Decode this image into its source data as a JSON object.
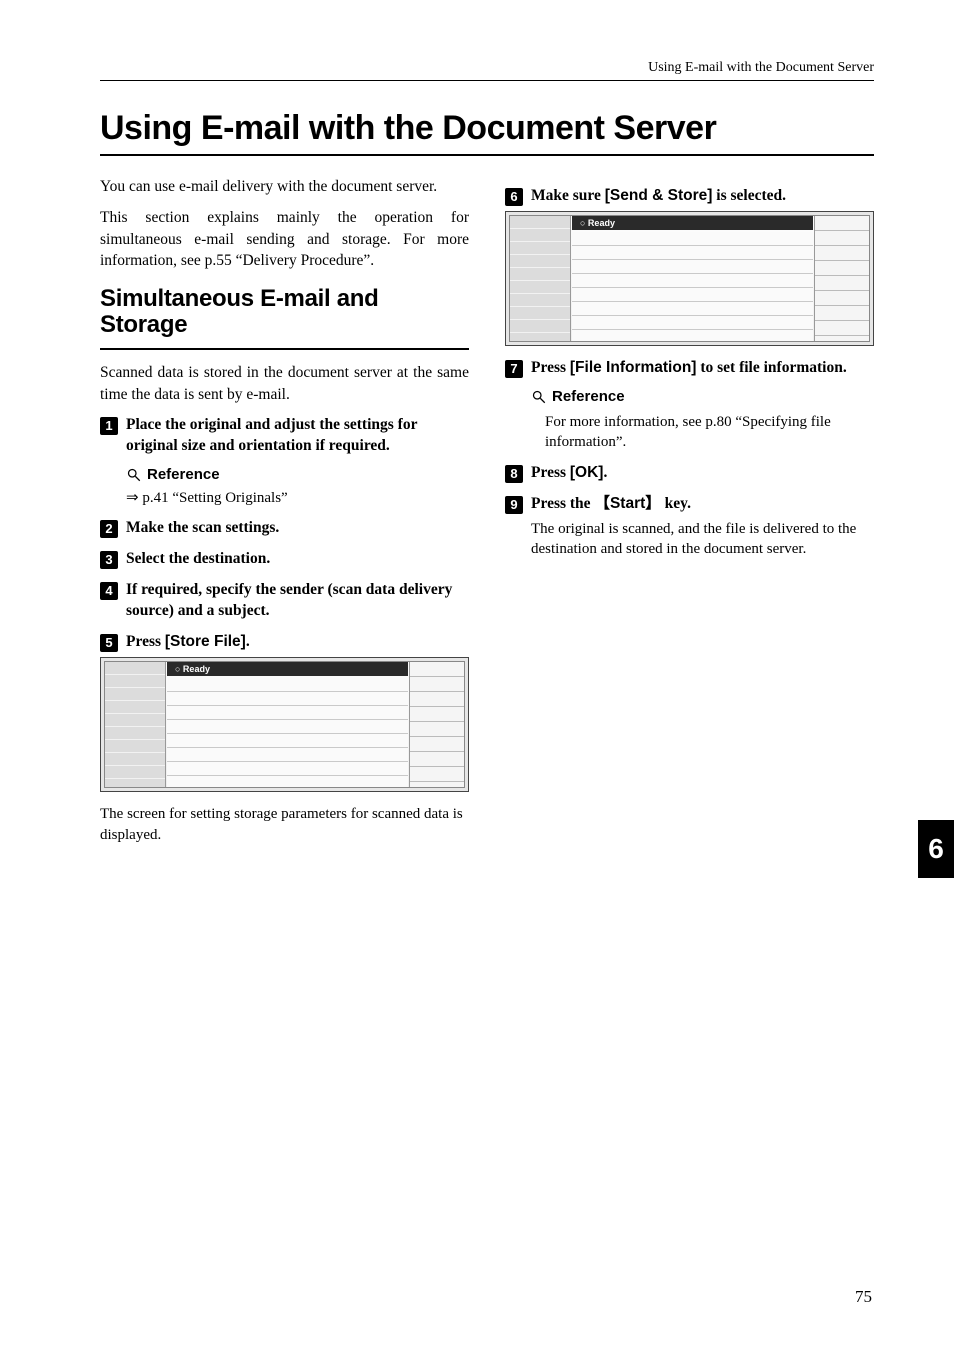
{
  "running_head": "Using E-mail with the Document Server",
  "title": "Using E-mail with the Document Server",
  "left": {
    "intro1": "You can use e-mail delivery with the document server.",
    "intro2": "This section explains mainly the operation for simultaneous e-mail sending and storage. For more information, see p.55 “Delivery Procedure”.",
    "h2": "Simultaneous E-mail and Storage",
    "h2_body": "Scanned data is stored in the document server at the same time the data is sent by e-mail.",
    "step1": "Place the original and adjust the settings for original size and orientation if required.",
    "reference_label": "Reference",
    "step1_ref": "⇒ p.41 “Setting Originals”",
    "step2": "Make the scan settings.",
    "step3": "Select the destination.",
    "step4": "If required, specify the sender (scan data delivery source) and a subject.",
    "step5_prefix": "Press ",
    "step5_label": "[Store File]",
    "step5_suffix": ".",
    "shot_ready": "○ Ready",
    "after_screenshot": "The screen for setting storage parameters for scanned data is displayed."
  },
  "right": {
    "step6_prefix": "Make sure ",
    "step6_label": "[Send & Store]",
    "step6_suffix": " is selected.",
    "shot_ready": "○ Ready",
    "step7_prefix": "Press ",
    "step7_label": "[File Information]",
    "step7_suffix": " to set file information.",
    "reference_label": "Reference",
    "step7_ref": "For more information, see p.80 “Specifying file information”.",
    "step8_prefix": "Press ",
    "step8_label": "[OK]",
    "step8_suffix": ".",
    "step9_prefix": "Press the ",
    "step9_key_open": "【",
    "step9_key": "Start",
    "step9_key_close": "】",
    "step9_suffix": " key.",
    "step9_body": "The original is scanned, and the file is delivered to the destination and stored in the document server."
  },
  "chapter_tab": "6",
  "page_number": "75"
}
